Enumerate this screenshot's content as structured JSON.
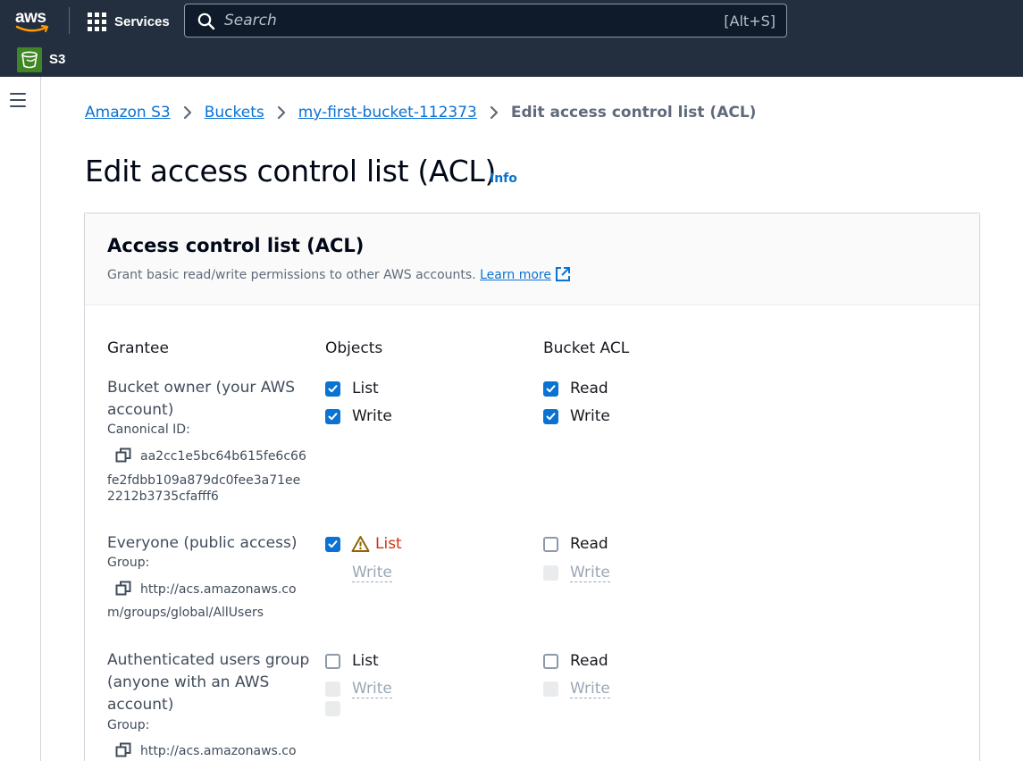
{
  "topnav": {
    "logo_text": "aws",
    "services_label": "Services",
    "search_placeholder": "Search",
    "search_shortcut": "[Alt+S]",
    "service_name": "S3"
  },
  "colors": {
    "nav_bg": "#232f3e",
    "link": "#0972d3",
    "checkbox_checked": "#0972d3",
    "warning": "#d13212",
    "s3_icon": "#3f8624"
  },
  "breadcrumb": {
    "items": [
      "Amazon S3",
      "Buckets",
      "my-first-bucket-112373"
    ],
    "current": "Edit access control list (ACL)"
  },
  "page": {
    "title": "Edit access control list (ACL)",
    "info_label": "Info"
  },
  "panel": {
    "title": "Access control list (ACL)",
    "description": "Grant basic read/write permissions to other AWS accounts.",
    "learn_more": "Learn more",
    "columns": {
      "grantee": "Grantee",
      "objects": "Objects",
      "bucket_acl": "Bucket ACL"
    }
  },
  "grantees": [
    {
      "name_line1": "Bucket owner (your AWS",
      "name_line2": "account)",
      "sub_label": "Canonical ID:",
      "id_lines": [
        "aa2cc1e5bc64b615fe6c66",
        "fe2fdbb109a879dc0fee3a71ee",
        "2212b3735cfafff6"
      ],
      "objects": [
        {
          "label": "List",
          "state": "checked"
        },
        {
          "label": "Write",
          "state": "checked"
        }
      ],
      "bucket_acl": [
        {
          "label": "Read",
          "state": "checked"
        },
        {
          "label": "Write",
          "state": "checked"
        }
      ]
    },
    {
      "name_line1": "Everyone (public access)",
      "sub_label": "Group:",
      "id_lines": [
        "http://acs.amazonaws.co",
        "m/groups/global/AllUsers"
      ],
      "objects": [
        {
          "label": "List",
          "state": "checked",
          "warning": true
        },
        {
          "label": "Write",
          "state": "disabled"
        }
      ],
      "bucket_acl": [
        {
          "label": "Read",
          "state": "unchecked"
        },
        {
          "label": "Write",
          "state": "disabled"
        }
      ]
    },
    {
      "name_line1": "Authenticated users group",
      "name_line2": "(anyone with an AWS",
      "name_line3": "account)",
      "sub_label": "Group:",
      "id_lines": [
        "http://acs.amazonaws.co"
      ],
      "objects": [
        {
          "label": "List",
          "state": "unchecked"
        },
        {
          "label": "Write",
          "state": "disabled"
        }
      ],
      "bucket_acl": [
        {
          "label": "Read",
          "state": "unchecked"
        },
        {
          "label": "Write",
          "state": "disabled"
        }
      ]
    }
  ]
}
